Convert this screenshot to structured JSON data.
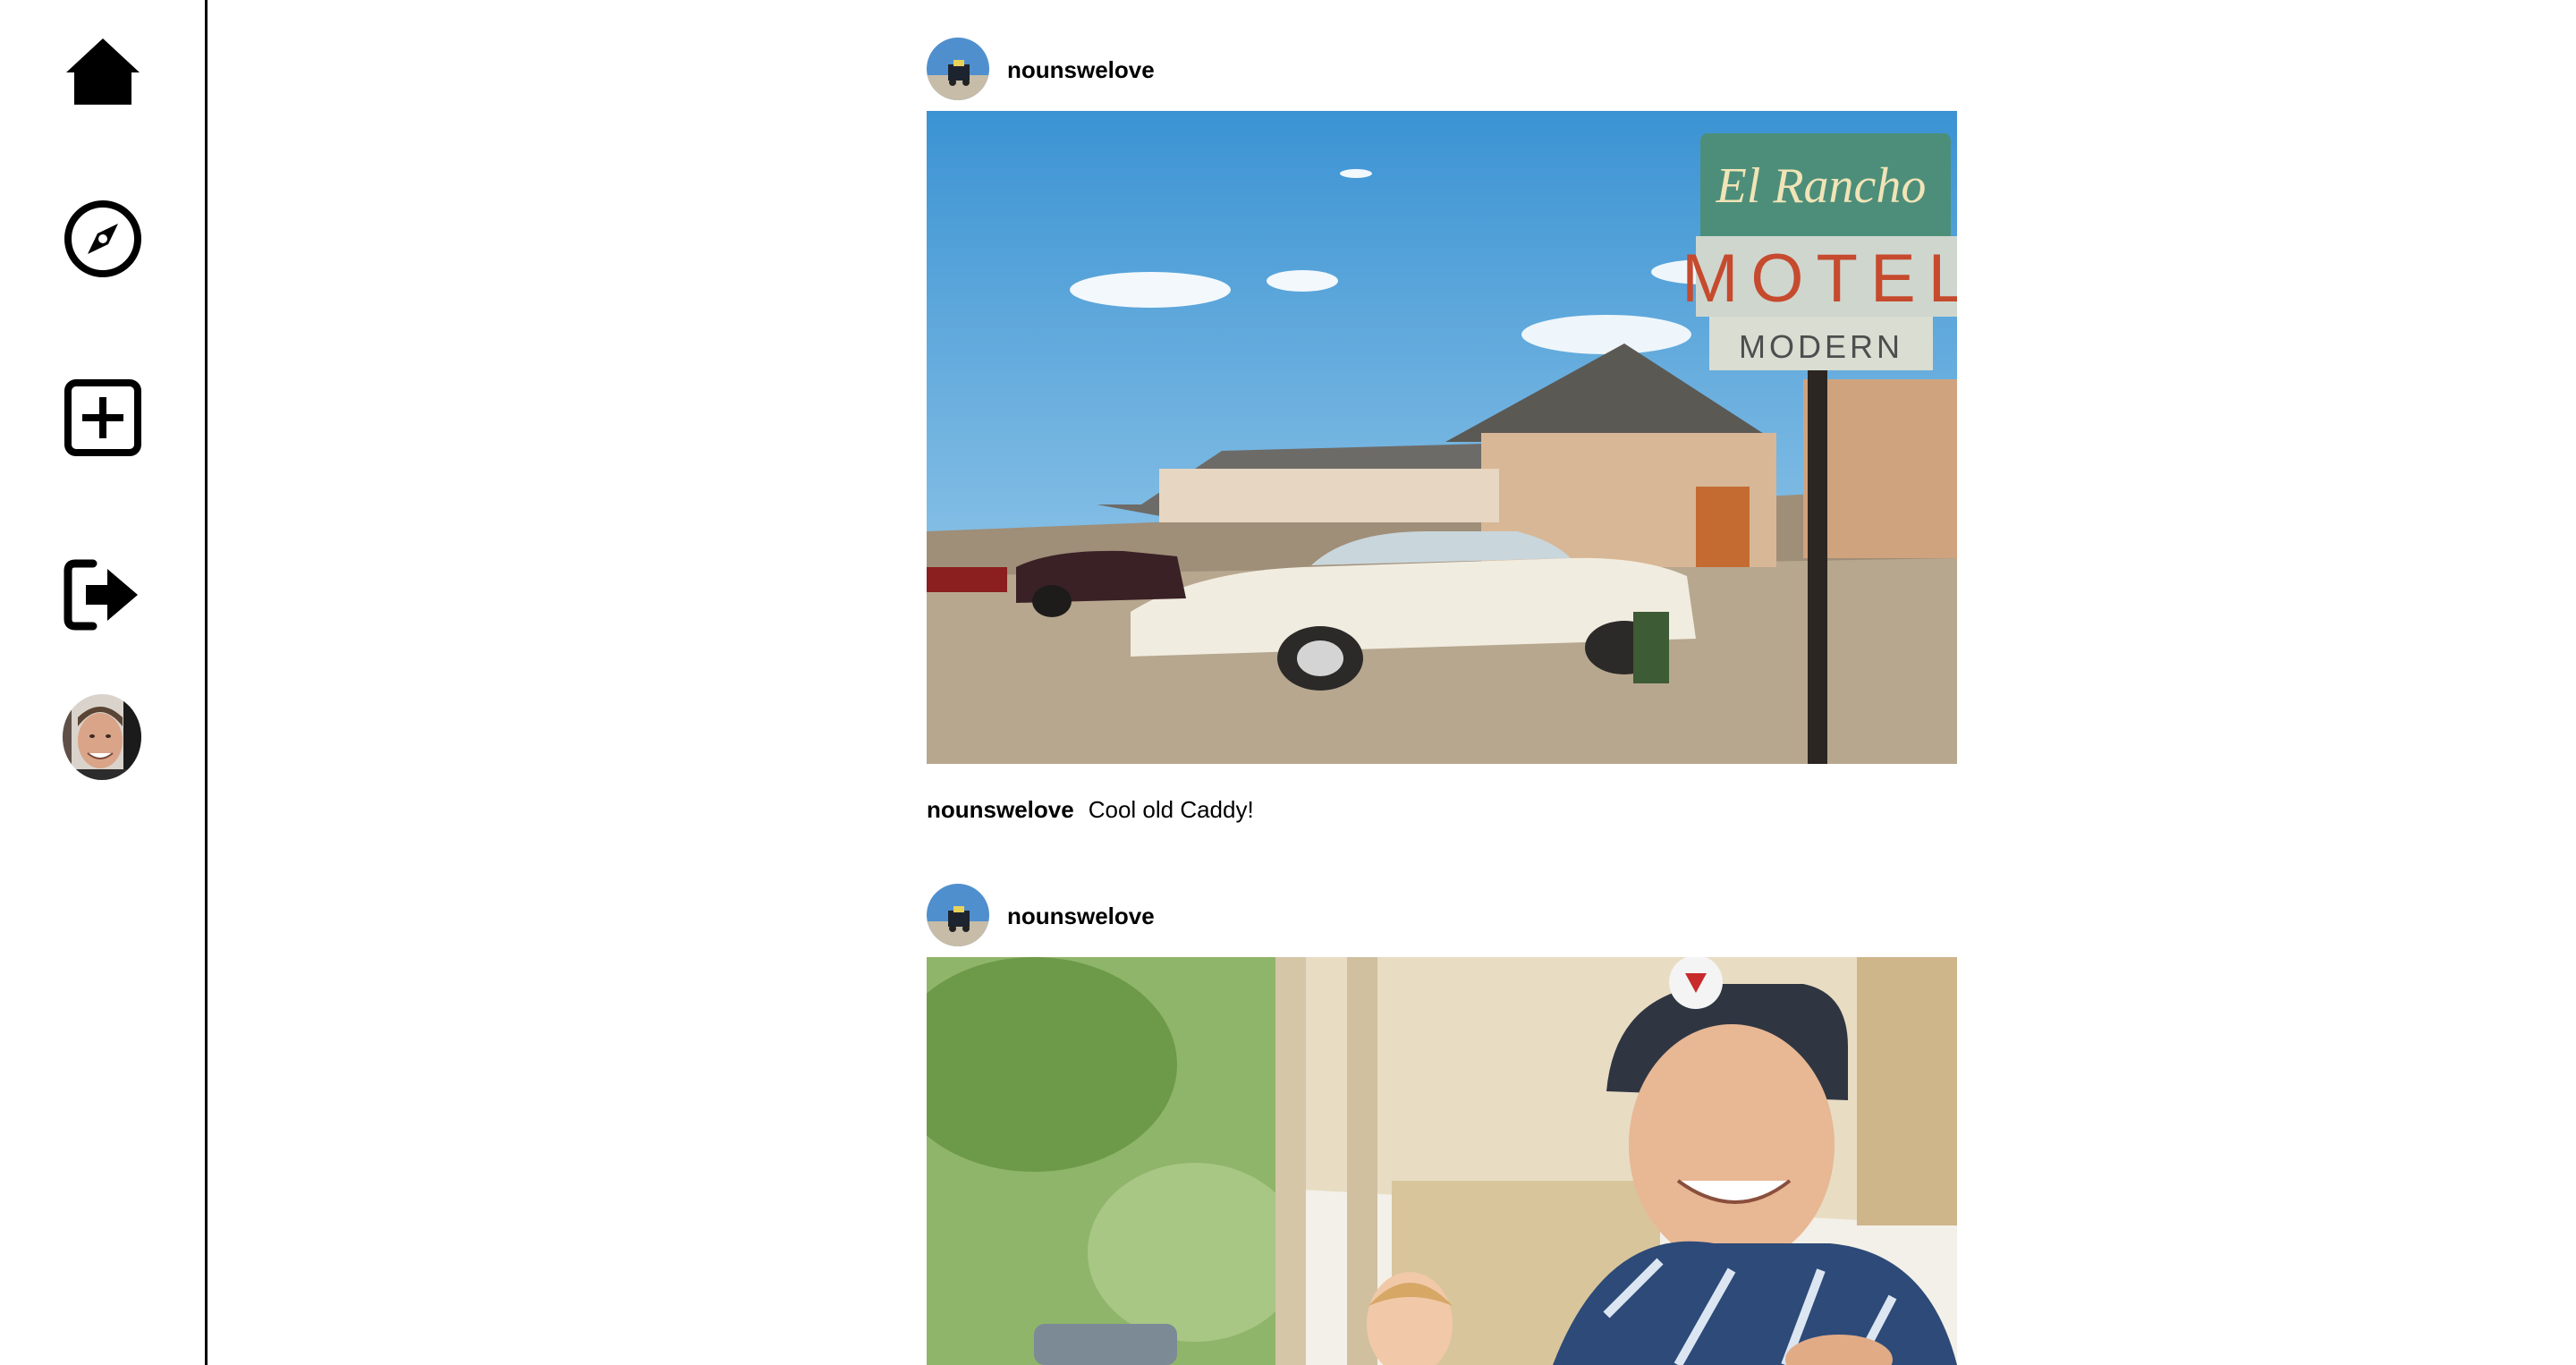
{
  "sidebar": {
    "items": [
      {
        "icon": "home-icon"
      },
      {
        "icon": "compass-icon"
      },
      {
        "icon": "plus-square-icon"
      },
      {
        "icon": "logout-icon"
      },
      {
        "icon": "profile-avatar"
      }
    ]
  },
  "feed": {
    "posts": [
      {
        "username": "nounswelove",
        "image_sign_script": "El Rancho",
        "image_sign_main": "MOTEL",
        "image_sign_sub": "MODERN",
        "caption_user": "nounswelove",
        "caption_text": "Cool old Caddy!"
      },
      {
        "username": "nounswelove"
      }
    ]
  },
  "colors": {
    "sky": "#3d9ad6",
    "sign_red": "#c64a2e",
    "car_white": "#f1ece0",
    "sidebar_border": "#000000"
  }
}
